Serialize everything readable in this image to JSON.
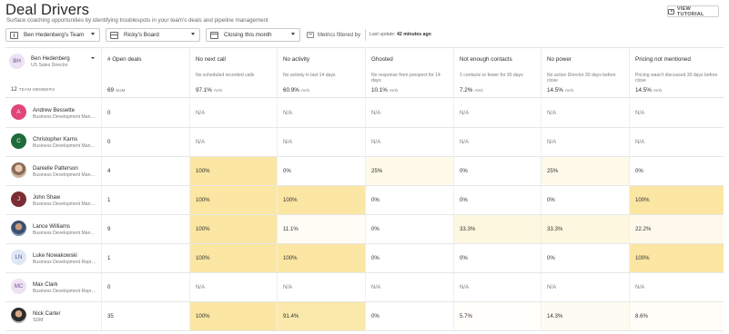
{
  "page": {
    "title": "Deal Drivers",
    "subtitle": "Surface coaching opportunities by identifying troublespots in your team's deals and pipeline management",
    "tutorial_label": "VIEW TUTORIAL"
  },
  "filters": {
    "team": "Ben Hedenberg's Team",
    "board": "Ricky's Board",
    "period": "Closing this month",
    "metrics_label": "Metrics filtered by",
    "last_update_label": "Last update:",
    "last_update_value": "42 minutes ago"
  },
  "manager": {
    "initials": "BH",
    "name": "Ben Hedenberg",
    "role": "US Sales Director",
    "team_count": "12",
    "team_members_label": "TEAM MEMBERS"
  },
  "columns": [
    {
      "name": "# Open deals",
      "desc": "",
      "value": "69",
      "unit": "SUM"
    },
    {
      "name": "No next call",
      "desc": "No scheduled recorded calls",
      "value": "97.1%",
      "unit": "AVG"
    },
    {
      "name": "No activity",
      "desc": "No activity in last 14 days",
      "value": "60.9%",
      "unit": "AVG"
    },
    {
      "name": "Ghosted",
      "desc": "No response from prospect for 14 days",
      "value": "10.1%",
      "unit": "AVG"
    },
    {
      "name": "Not enough contacts",
      "desc": "1 contacts or fewer for 30 days",
      "value": "7.2%",
      "unit": "AVG"
    },
    {
      "name": "No power",
      "desc": "No active Director 30 days before close",
      "value": "14.5%",
      "unit": "AVG"
    },
    {
      "name": "Pricing not mentioned",
      "desc": "Pricing wasn't discussed 30 days before close",
      "value": "14.5%",
      "unit": "AVG"
    }
  ],
  "rows": [
    {
      "name": "Andrew Bessette",
      "role": "Business Development Manager",
      "initials": "A",
      "avatar": "av-a",
      "cells": [
        "0",
        "N/A",
        "N/A",
        "N/A",
        "N/A",
        "N/A",
        "N/A"
      ]
    },
    {
      "name": "Christopher Karns",
      "role": "Business Development Manager",
      "initials": "C",
      "avatar": "av-c",
      "cells": [
        "0",
        "N/A",
        "N/A",
        "N/A",
        "N/A",
        "N/A",
        "N/A"
      ]
    },
    {
      "name": "Danielle Patterson",
      "role": "Business Development Manager",
      "initials": "",
      "avatar": "av-photo1",
      "cells": [
        "4",
        "100%",
        "0%",
        "25%",
        "0%",
        "25%",
        "0%"
      ]
    },
    {
      "name": "John Shaw",
      "role": "Business Development Manager",
      "initials": "J",
      "avatar": "av-j",
      "cells": [
        "1",
        "100%",
        "100%",
        "0%",
        "0%",
        "0%",
        "100%"
      ]
    },
    {
      "name": "Lance Williams",
      "role": "Business Development Manager",
      "initials": "",
      "avatar": "av-photo2",
      "cells": [
        "9",
        "100%",
        "11.1%",
        "0%",
        "33.3%",
        "33.3%",
        "22.2%"
      ]
    },
    {
      "name": "Luke Nowakowski",
      "role": "Business Development Representative",
      "initials": "LN",
      "avatar": "av-ln",
      "cells": [
        "1",
        "100%",
        "100%",
        "0%",
        "0%",
        "0%",
        "100%"
      ]
    },
    {
      "name": "Max Clark",
      "role": "Business Development Representative",
      "initials": "MC",
      "avatar": "av-mc",
      "cells": [
        "0",
        "N/A",
        "N/A",
        "N/A",
        "N/A",
        "N/A",
        "N/A"
      ]
    },
    {
      "name": "Nick Carter",
      "role": "SDM",
      "initials": "",
      "avatar": "av-photo3",
      "cells": [
        "35",
        "100%",
        "91.4%",
        "0%",
        "5.7%",
        "14.3%",
        "8.6%"
      ]
    }
  ],
  "heat_colors": {
    "max": "#fbe6a3",
    "zero": "#ffffff"
  }
}
